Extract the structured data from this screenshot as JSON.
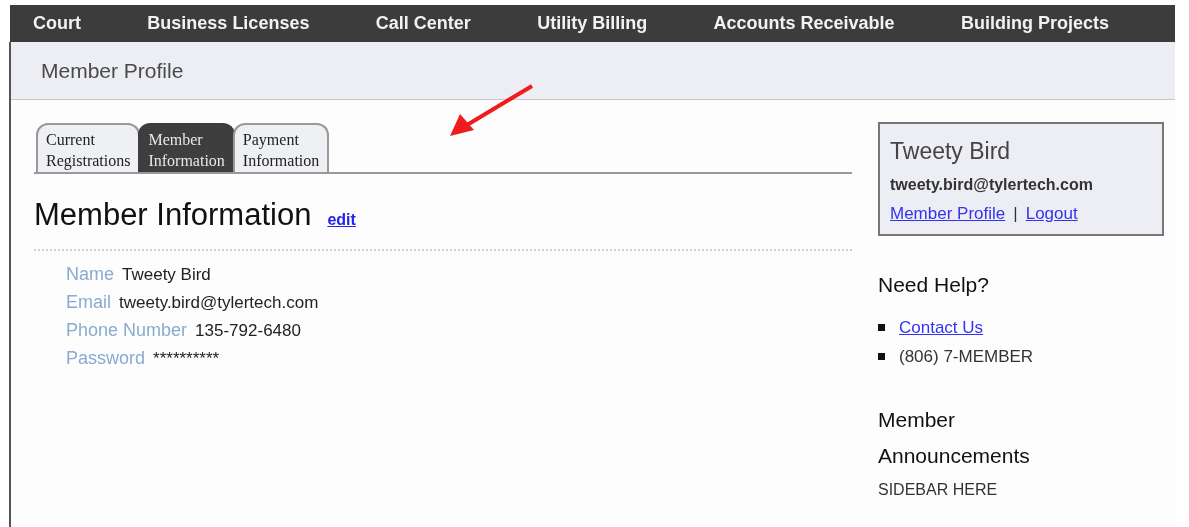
{
  "nav": [
    "Court",
    "Business Licenses",
    "Call Center",
    "Utility Billing",
    "Accounts Receivable",
    "Building Projects"
  ],
  "page_title": "Member Profile",
  "tabs": [
    {
      "line1": "Current",
      "line2": "Registrations",
      "selected": false
    },
    {
      "line1": "Member",
      "line2": "Information",
      "selected": true
    },
    {
      "line1": "Payment",
      "line2": "Information",
      "selected": false
    }
  ],
  "section": {
    "title": "Member Information",
    "edit_link": "edit"
  },
  "fields": [
    {
      "label": "Name",
      "value": "Tweety Bird"
    },
    {
      "label": "Email",
      "value": "tweety.bird@tylertech.com"
    },
    {
      "label": "Phone Number",
      "value": "135-792-6480"
    },
    {
      "label": "Password",
      "value": "**********"
    }
  ],
  "account_box": {
    "name": "Tweety Bird",
    "email": "tweety.bird@tylertech.com",
    "profile_link": "Member Profile",
    "separator": "|",
    "logout_link": "Logout"
  },
  "help": {
    "title": "Need Help?",
    "items": [
      {
        "kind": "link",
        "text": "Contact Us"
      },
      {
        "kind": "text",
        "text": "(806) 7-MEMBER"
      }
    ]
  },
  "announcements": {
    "title_line1": "Member",
    "title_line2": "Announcements",
    "body": "SIDEBAR HERE"
  }
}
